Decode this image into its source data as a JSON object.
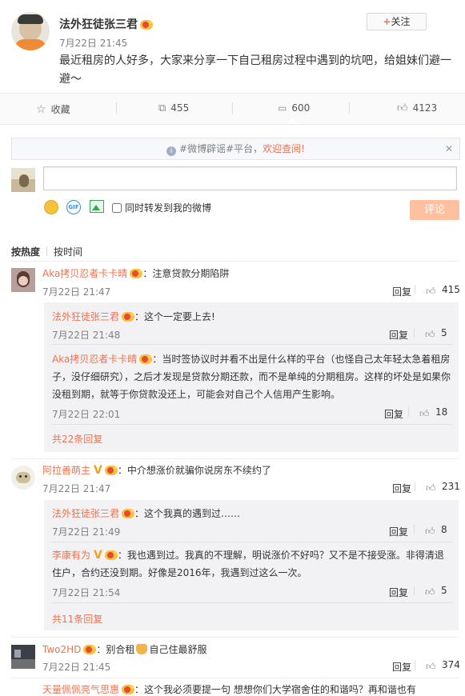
{
  "post": {
    "author": "法外狂徒张三君",
    "time": "7月22日 21:45",
    "follow_label": "关注",
    "follow_plus": "+",
    "content": "最近租房的人好多，大家来分享一下自己租房过程中遇到的坑吧，给姐妹们避一避～"
  },
  "actions": {
    "collect": "收藏",
    "repost": "455",
    "comment": "600",
    "like": "4123"
  },
  "notice": {
    "prefix": "#微博辟谣#平台，",
    "link": "欢迎查阅!"
  },
  "composer": {
    "placeholder": "",
    "repost_label": "同时转发到我的微博",
    "submit_label": "评论"
  },
  "sort": {
    "hot": "按热度",
    "time": "按时间"
  },
  "comments": [
    {
      "author": "Aka拷贝忍者卡卡晴",
      "text": "注意贷款分期陷阱",
      "time": "7月22日 21:47",
      "reply_label": "回复",
      "likes": "415",
      "replies": [
        {
          "author": "法外狂徒张三君",
          "text": "这个一定要上去!",
          "time": "7月22日 21:48",
          "reply_label": "回复",
          "likes": "5"
        },
        {
          "author": "Aka拷贝忍者卡卡晴",
          "text": "当时签协议时并看不出是什么样的平台（也怪自己太年轻太急着租房子，没仔细研究），之后才发现是贷款分期还款，而不是单纯的分期租房。这样的坏处是如果你没租到期，就等于你贷款没还上，可能会对自己个人信用产生影响。",
          "time": "7月22日 22:01",
          "reply_label": "回复",
          "likes": "18"
        }
      ],
      "more": "共22条回复"
    },
    {
      "author": "阿拉善萌主",
      "text": "中介想涨价就骗你说房东不续约了",
      "time": "7月22日 21:47",
      "reply_label": "回复",
      "likes": "231",
      "replies": [
        {
          "author": "法外狂徒张三君",
          "text": "这个我真的遇到过……",
          "time": "7月22日 21:49",
          "reply_label": "回复",
          "likes": "8"
        },
        {
          "author": "李康有为",
          "text": "我也遇到过。我真的不理解，明说涨价不好吗？又不是不接受涨。非得清退住户，合约还没到期。好像是2016年，我遇到过这么一次。",
          "time": "7月22日 21:54",
          "reply_label": "回复",
          "likes": "5"
        }
      ],
      "more": "共11条回复"
    },
    {
      "author": "Two2HD",
      "text": "别合租",
      "text2": "自己住最舒服",
      "time": "7月22日 21:45",
      "reply_label": "回复",
      "likes": "374"
    },
    {
      "author": "天量佩佩亮气思惠",
      "text": "这个我必须要提一句 想想你们大学宿舍住的和谐吗？再和谐也有"
    }
  ],
  "colors": {
    "accent": "#eb7350",
    "link": "#eb7350",
    "submit_bg": "#ffc09f"
  }
}
